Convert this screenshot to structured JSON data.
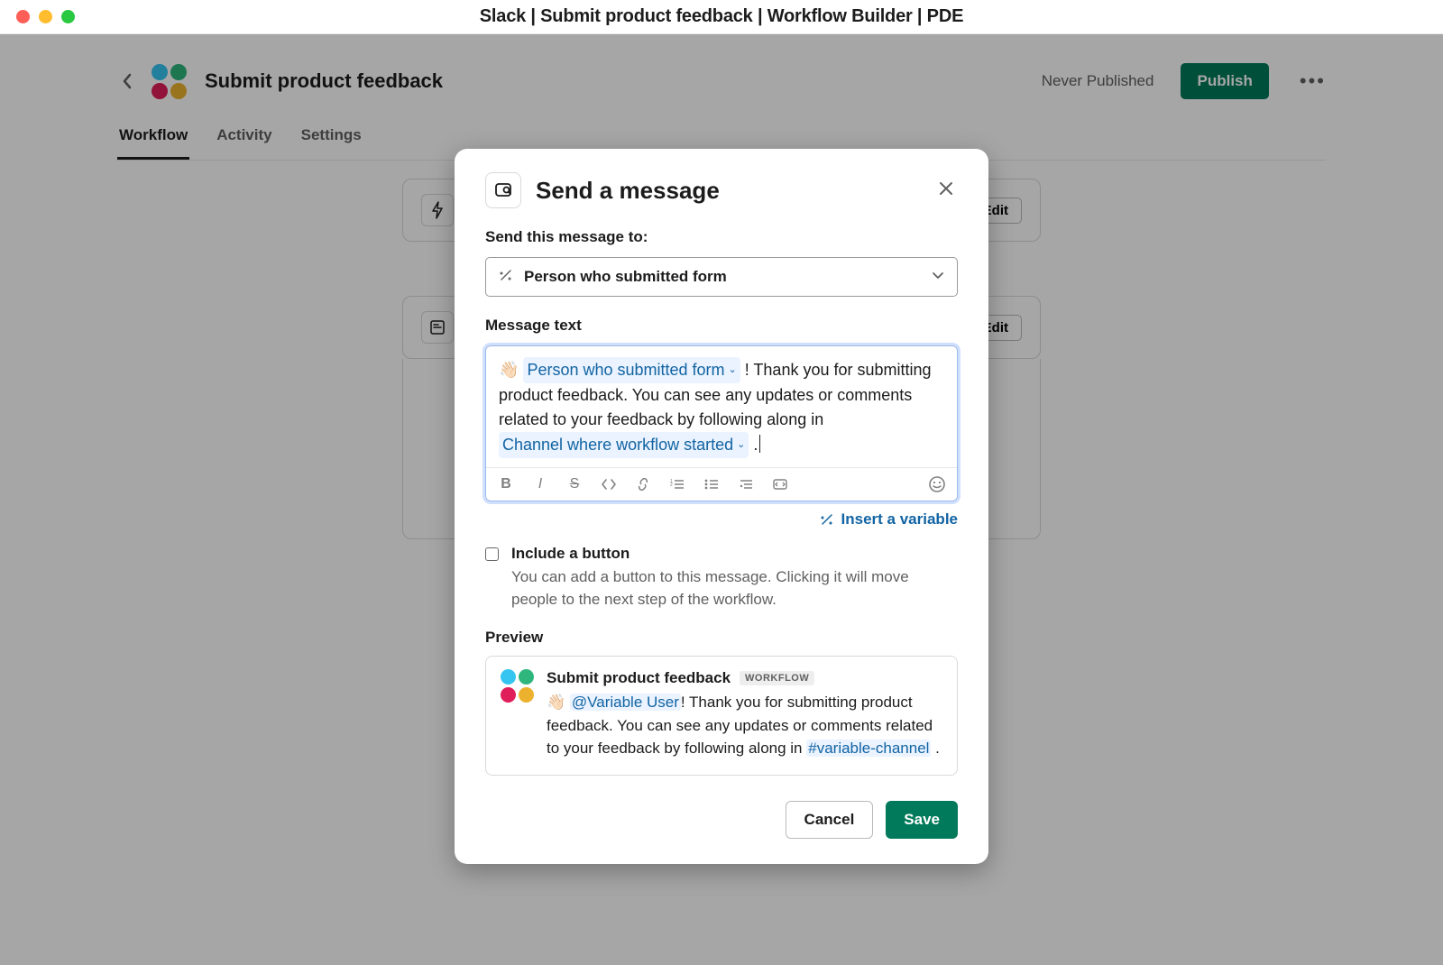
{
  "window_title": "Slack | Submit product feedback | Workflow Builder | PDE",
  "header": {
    "workflow_name": "Submit product feedback",
    "status_text": "Never Published",
    "publish_label": "Publish"
  },
  "tabs": [
    "Workflow",
    "Activity",
    "Settings"
  ],
  "steps": {
    "edit_label": "Edit"
  },
  "modal": {
    "title": "Send a message",
    "send_to_label": "Send this message to:",
    "send_to_value": "Person who submitted form",
    "message_label": "Message text",
    "message": {
      "emoji": "👋🏻",
      "var1": "Person who submitted form",
      "text1": " ! Thank you for submitting product feedback. You can see any updates or comments related to your feedback by following along in ",
      "var2": "Channel where workflow started",
      "text2": " ."
    },
    "insert_variable_label": "Insert a variable",
    "include_button_label": "Include a button",
    "include_button_desc": "You can add a button to this message. Clicking it will move people to the next step of the workflow.",
    "preview_label": "Preview",
    "preview": {
      "app_name": "Submit product feedback",
      "badge": "WORKFLOW",
      "emoji": "👋🏻",
      "mention": "@Variable User",
      "body1": "! Thank you for submitting product feedback. You can see any updates or comments related to your feedback by following along in ",
      "channel": "#variable-channel",
      "body2": " ."
    },
    "cancel_label": "Cancel",
    "save_label": "Save"
  }
}
